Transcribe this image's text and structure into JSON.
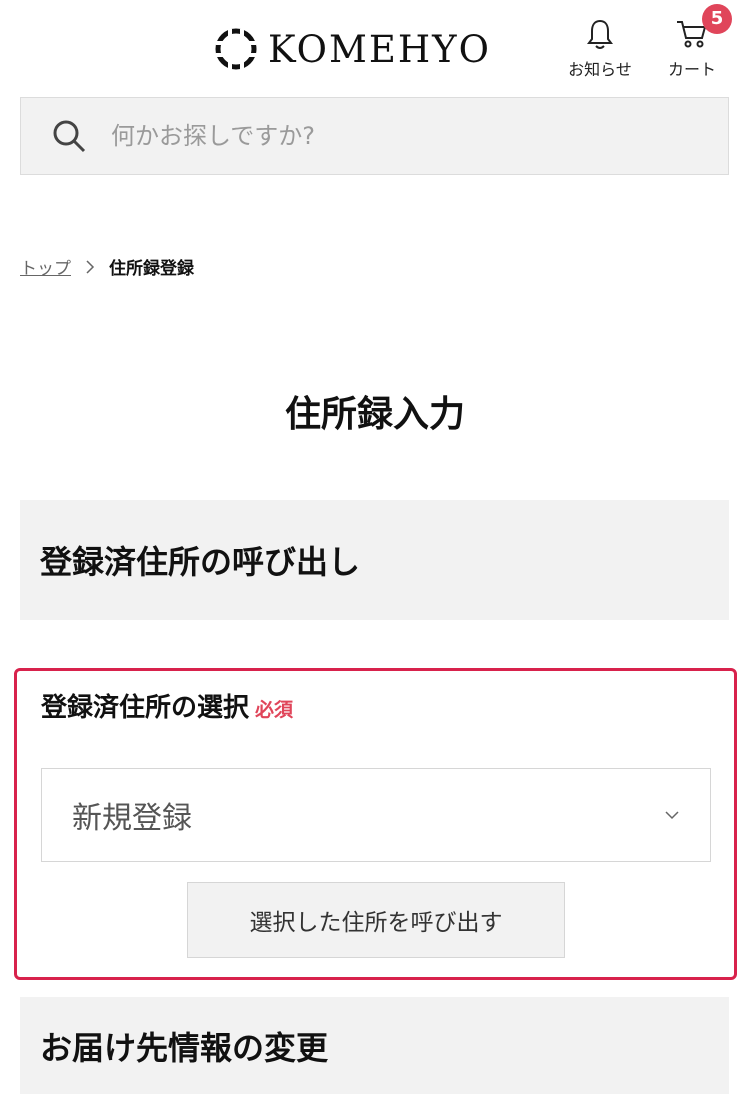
{
  "header": {
    "logo_text": "KOMEHYO",
    "notifications_label": "お知らせ",
    "cart_label": "カート",
    "cart_count": "5"
  },
  "search": {
    "placeholder": "何かお探しですか?"
  },
  "breadcrumb": {
    "home": "トップ",
    "current": "住所録登録"
  },
  "page": {
    "title": "住所録入力"
  },
  "sections": {
    "recall_title": "登録済住所の呼び出し",
    "select_label": "登録済住所の選択",
    "required_label": "必須",
    "selected_value": "新規登録",
    "recall_button": "選択した住所を呼び出す",
    "delivery_title": "お届け先情報の変更"
  },
  "colors": {
    "accent": "#d8224c",
    "badge": "#e0455a",
    "panel": "#f2f2f2"
  }
}
